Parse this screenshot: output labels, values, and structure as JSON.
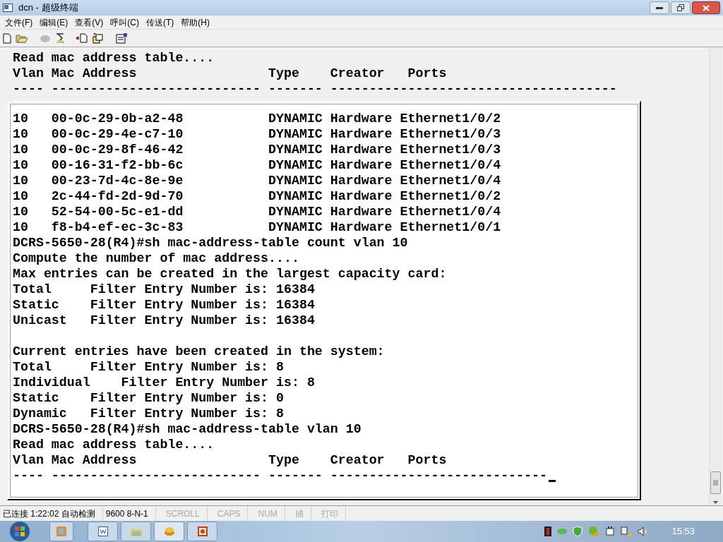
{
  "window": {
    "title": "dcn - 超级终端"
  },
  "menu": [
    "文件(F)",
    "编辑(E)",
    "查看(V)",
    "呼叫(C)",
    "传送(T)",
    "帮助(H)"
  ],
  "terminal": {
    "header_lines": [
      {
        "text": "Read mac address table...."
      },
      {
        "text": "Vlan Mac Address                 Type    Creator   Ports"
      },
      {
        "text": "---- --------------------------- ------- -------------------------------------"
      }
    ],
    "panel_lines": [
      {
        "text": "10   00-0c-29-0b-a2-48           DYNAMIC Hardware Ethernet1/0/2"
      },
      {
        "text": "10   00-0c-29-4e-c7-10           DYNAMIC Hardware Ethernet1/0/3"
      },
      {
        "text": "10   00-0c-29-8f-46-42           DYNAMIC Hardware Ethernet1/0/3"
      },
      {
        "text": "10   00-16-31-f2-bb-6c           DYNAMIC Hardware Ethernet1/0/4"
      },
      {
        "text": "10   00-23-7d-4c-8e-9e           DYNAMIC Hardware Ethernet1/0/4"
      },
      {
        "text": "10   2c-44-fd-2d-9d-70           DYNAMIC Hardware Ethernet1/0/2"
      },
      {
        "text": "10   52-54-00-5c-e1-dd           DYNAMIC Hardware Ethernet1/0/4"
      },
      {
        "text": "10   f8-b4-ef-ec-3c-83           DYNAMIC Hardware Ethernet1/0/1"
      },
      {
        "text": "DCRS-5650-28(R4)#sh mac-address-table count vlan 10"
      },
      {
        "text": "Compute the number of mac address...."
      },
      {
        "text": "Max entries can be created in the largest capacity card:"
      },
      {
        "text": "Total     Filter Entry Number is: 16384"
      },
      {
        "text": "Static    Filter Entry Number is: 16384"
      },
      {
        "text": "Unicast   Filter Entry Number is: 16384"
      },
      {
        "text": "Current entries have been created in the system:",
        "gap_before": true
      },
      {
        "text": "Total     Filter Entry Number is: 8"
      },
      {
        "text": "Individual    Filter Entry Number is: 8"
      },
      {
        "text": "Static    Filter Entry Number is: 0"
      },
      {
        "text": "Dynamic   Filter Entry Number is: 8"
      },
      {
        "text": "DCRS-5650-28(R4)#sh mac-address-table vlan 10"
      },
      {
        "text": "Read mac address table...."
      },
      {
        "text": "Vlan Mac Address                 Type    Creator   Ports"
      },
      {
        "text": "---- --------------------------- ------- ----------------------------",
        "cursor": true
      }
    ]
  },
  "status_bar": [
    {
      "text": "已连接 1:22:02 自动检测",
      "disabled": false
    },
    {
      "text": "9600 8-N-1",
      "disabled": false
    },
    {
      "text": "SCROLL",
      "disabled": true
    },
    {
      "text": "CAPS",
      "disabled": true
    },
    {
      "text": "NUM",
      "disabled": true
    },
    {
      "text": "捕",
      "disabled": true
    },
    {
      "text": "打印",
      "disabled": true
    }
  ],
  "taskbar": {
    "clock": "15:53"
  }
}
